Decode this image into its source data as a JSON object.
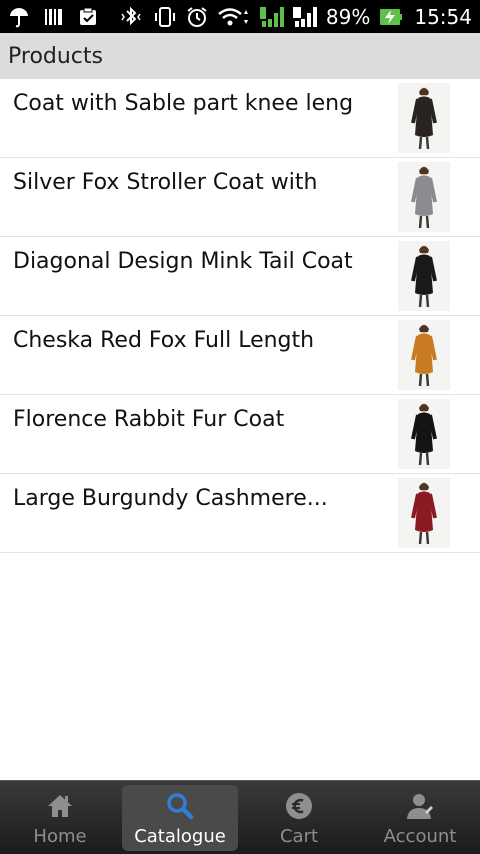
{
  "status_bar": {
    "battery_percent": "89%",
    "time": "15:54",
    "icons": [
      "umbrella-icon",
      "barcode-icon",
      "clipboard-icon",
      "bluetooth-icon",
      "vibrate-icon",
      "alarm-icon",
      "wifi-icon",
      "signal-1-icon",
      "signal-2-icon",
      "battery-charging-icon"
    ]
  },
  "header": {
    "title": "Products"
  },
  "products": [
    {
      "name": "Coat with Sable part knee leng",
      "coat_color": "#2a2420"
    },
    {
      "name": "Silver Fox Stroller Coat with",
      "coat_color": "#8c8a90"
    },
    {
      "name": "Diagonal Design Mink Tail Coat",
      "coat_color": "#1b1818"
    },
    {
      "name": "Cheska Red Fox Full Length",
      "coat_color": "#c97b22"
    },
    {
      "name": "Florence Rabbit Fur Coat",
      "coat_color": "#141414"
    },
    {
      "name": "Large Burgundy Cashmere...",
      "coat_color": "#8c1a22"
    }
  ],
  "tabs": [
    {
      "label": "Home",
      "icon": "home-icon",
      "active": false
    },
    {
      "label": "Catalogue",
      "icon": "search-icon",
      "active": true
    },
    {
      "label": "Cart",
      "icon": "euro-icon",
      "active": false
    },
    {
      "label": "Account",
      "icon": "account-icon",
      "active": false
    }
  ],
  "colors": {
    "active_tab_icon": "#2f7fd6",
    "inactive_tab_icon": "#8e8e8e",
    "header_bg": "#dcdcdc",
    "battery_green": "#5ec24a"
  }
}
